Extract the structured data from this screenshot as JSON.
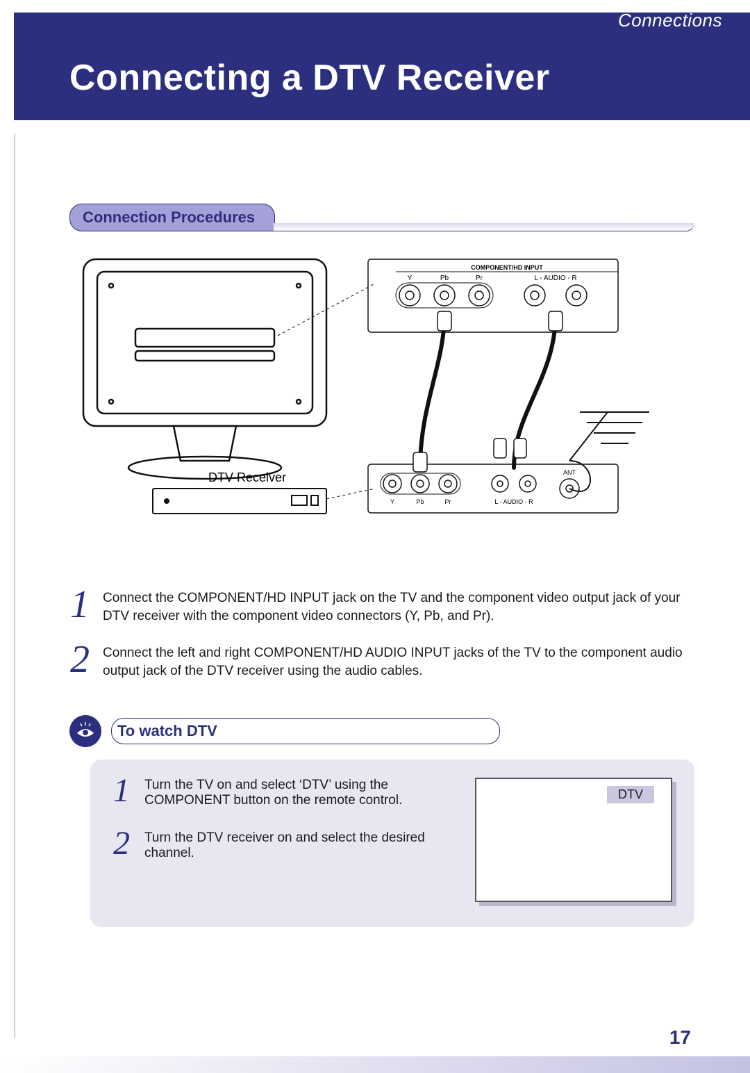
{
  "header": {
    "section": "Connections",
    "title": "Connecting a DTV Receiver"
  },
  "proc_heading": "Connection Procedures",
  "diagram": {
    "tv_back_label": "",
    "dtv_receiver_label": "DTV Receiver",
    "tv_panel_title": "COMPONENT/HD INPUT",
    "component_jacks": {
      "y": "Y",
      "pb": "Pb",
      "pr": "Pr"
    },
    "audio_jacks": {
      "l": "L",
      "aud": "AUDIO",
      "r": "R",
      "combined": "L - AUDIO - R"
    },
    "receiver_panel": {
      "y": "Y",
      "pb": "Pb",
      "pr": "Pr",
      "audio": "L - AUDIO - R",
      "ant": "ANT"
    }
  },
  "steps": [
    "Connect the COMPONENT/HD INPUT jack on the TV and the component video output jack of your DTV receiver with the component video connectors (Y, Pb, and Pr).",
    "Connect the left and right COMPONENT/HD AUDIO INPUT jacks of the TV to the component audio output jack of the DTV receiver using the audio cables."
  ],
  "watch": {
    "heading": "To watch DTV",
    "steps": [
      "Turn the TV on and select ‘DTV’ using the COMPONENT button on the remote control.",
      "Turn the DTV receiver on and select the desired channel."
    ],
    "screen_label": "DTV"
  },
  "page_number": "17"
}
